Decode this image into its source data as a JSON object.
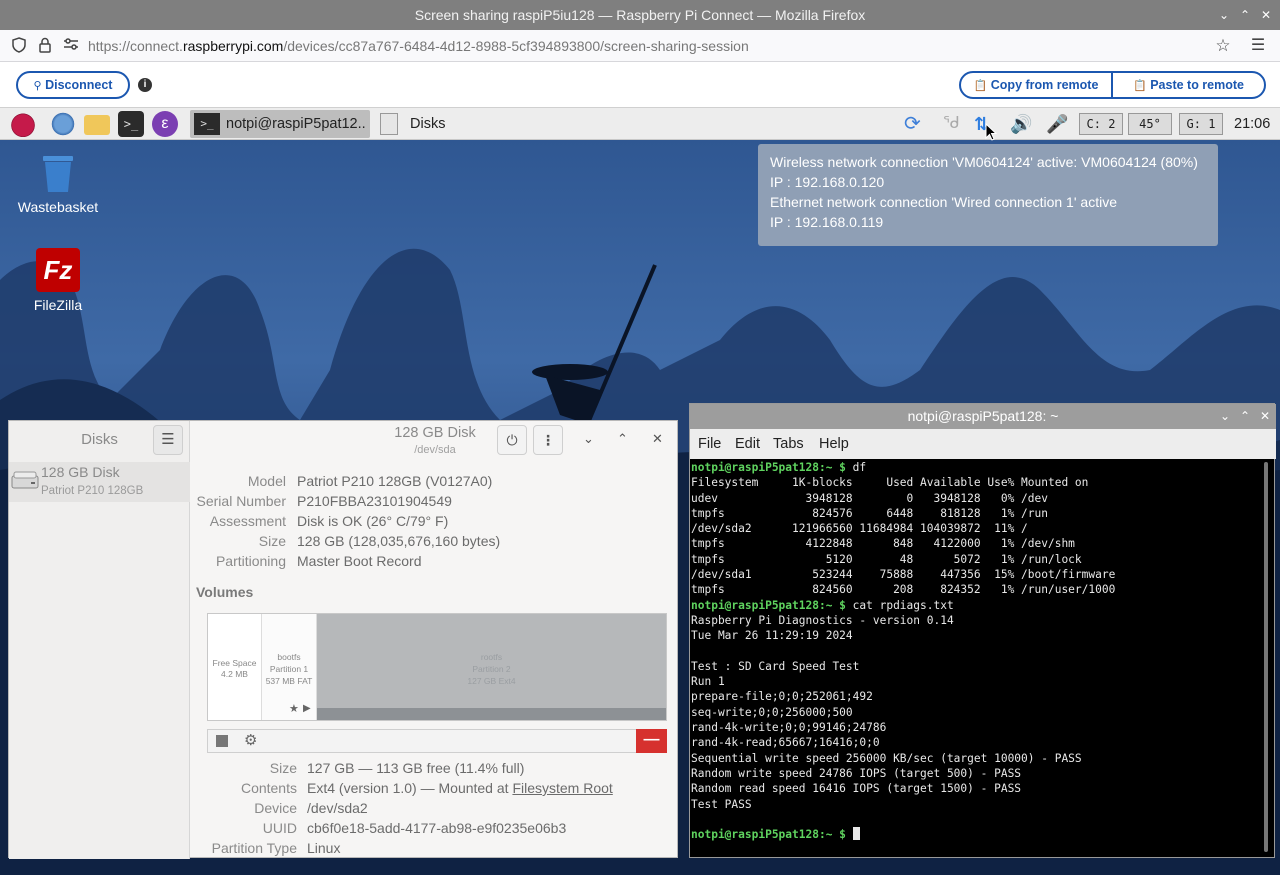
{
  "browser": {
    "window_title": "Screen sharing raspiP5iu128 — Raspberry Pi Connect — Mozilla Firefox",
    "url_prefix": "https://connect.",
    "url_domain": "raspberrypi.com",
    "url_path": "/devices/cc87a767-6484-4d12-8988-5cf394893800/screen-sharing-session"
  },
  "connect_toolbar": {
    "disconnect_label": "Disconnect",
    "copy_label": "Copy from remote",
    "paste_label": "Paste to remote"
  },
  "taskbar": {
    "tasks": [
      {
        "label": "notpi@raspiP5pat12.."
      },
      {
        "label": "Disks"
      }
    ],
    "cpu_monitor": "C: 2",
    "temp_monitor": "45°",
    "gpu_monitor": "G: 1",
    "clock": "21:06"
  },
  "desktop": {
    "icons": [
      {
        "label": "Wastebasket"
      },
      {
        "label": "FileZilla"
      }
    ]
  },
  "network_tooltip": {
    "lines": [
      "Wireless network connection 'VM0604124' active: VM0604124 (80%)",
      "IP : 192.168.0.120",
      "Ethernet network connection 'Wired connection 1' active",
      "IP : 192.168.0.119"
    ]
  },
  "disks": {
    "sidebar_title": "Disks",
    "device_name": "128 GB Disk",
    "device_sub": "Patriot P210 128GB",
    "header_title": "128 GB Disk",
    "header_sub": "/dev/sda",
    "drive_info": [
      {
        "key": "Model",
        "value": "Patriot P210 128GB (V0127A0)"
      },
      {
        "key": "Serial Number",
        "value": "P210FBBA23101904549"
      },
      {
        "key": "Assessment",
        "value": "Disk is OK (26° C/79° F)"
      },
      {
        "key": "Size",
        "value": "128 GB (128,035,676,160 bytes)"
      },
      {
        "key": "Partitioning",
        "value": "Master Boot Record"
      }
    ],
    "volumes_heading": "Volumes",
    "segments": [
      {
        "name": "Free Space",
        "size": "4.2 MB"
      },
      {
        "name": "bootfs",
        "sub": "Partition 1",
        "size": "537 MB FAT"
      },
      {
        "name": "rootfs",
        "sub": "Partition 2",
        "size": "127 GB Ext4"
      }
    ],
    "partition_info": [
      {
        "key": "Size",
        "value": "127 GB — 113 GB free (11.4% full)"
      },
      {
        "key": "Contents",
        "value": "Ext4 (version 1.0) — Mounted at ",
        "link": "Filesystem Root"
      },
      {
        "key": "Device",
        "value": "/dev/sda2"
      },
      {
        "key": "UUID",
        "value": "cb6f0e18-5add-4177-ab98-e9f0235e06b3"
      },
      {
        "key": "Partition Type",
        "value": "Linux"
      }
    ]
  },
  "terminal": {
    "title": "notpi@raspiP5pat128: ~",
    "menu": [
      "File",
      "Edit",
      "Tabs",
      "Help"
    ],
    "prompt": "notpi@raspiP5pat128:~ $",
    "lines": [
      {
        "prompt": true,
        "text": " df"
      },
      {
        "text": "Filesystem     1K-blocks     Used Available Use% Mounted on"
      },
      {
        "text": "udev             3948128        0   3948128   0% /dev"
      },
      {
        "text": "tmpfs             824576     6448    818128   1% /run"
      },
      {
        "text": "/dev/sda2      121966560 11684984 104039872  11% /"
      },
      {
        "text": "tmpfs            4122848      848   4122000   1% /dev/shm"
      },
      {
        "text": "tmpfs               5120       48      5072   1% /run/lock"
      },
      {
        "text": "/dev/sda1         523244    75888    447356  15% /boot/firmware"
      },
      {
        "text": "tmpfs             824560      208    824352   1% /run/user/1000"
      },
      {
        "prompt": true,
        "text": " cat rpdiags.txt"
      },
      {
        "text": "Raspberry Pi Diagnostics - version 0.14"
      },
      {
        "text": "Tue Mar 26 11:29:19 2024"
      },
      {
        "text": ""
      },
      {
        "text": "Test : SD Card Speed Test"
      },
      {
        "text": "Run 1"
      },
      {
        "text": "prepare-file;0;0;252061;492"
      },
      {
        "text": "seq-write;0;0;256000;500"
      },
      {
        "text": "rand-4k-write;0;0;99146;24786"
      },
      {
        "text": "rand-4k-read;65667;16416;0;0"
      },
      {
        "text": "Sequential write speed 256000 KB/sec (target 10000) - PASS"
      },
      {
        "text": "Random write speed 24786 IOPS (target 500) - PASS"
      },
      {
        "text": "Random read speed 16416 IOPS (target 1500) - PASS"
      },
      {
        "text": "Test PASS"
      },
      {
        "text": ""
      },
      {
        "prompt": true,
        "text": " ",
        "cursor": true
      }
    ]
  }
}
